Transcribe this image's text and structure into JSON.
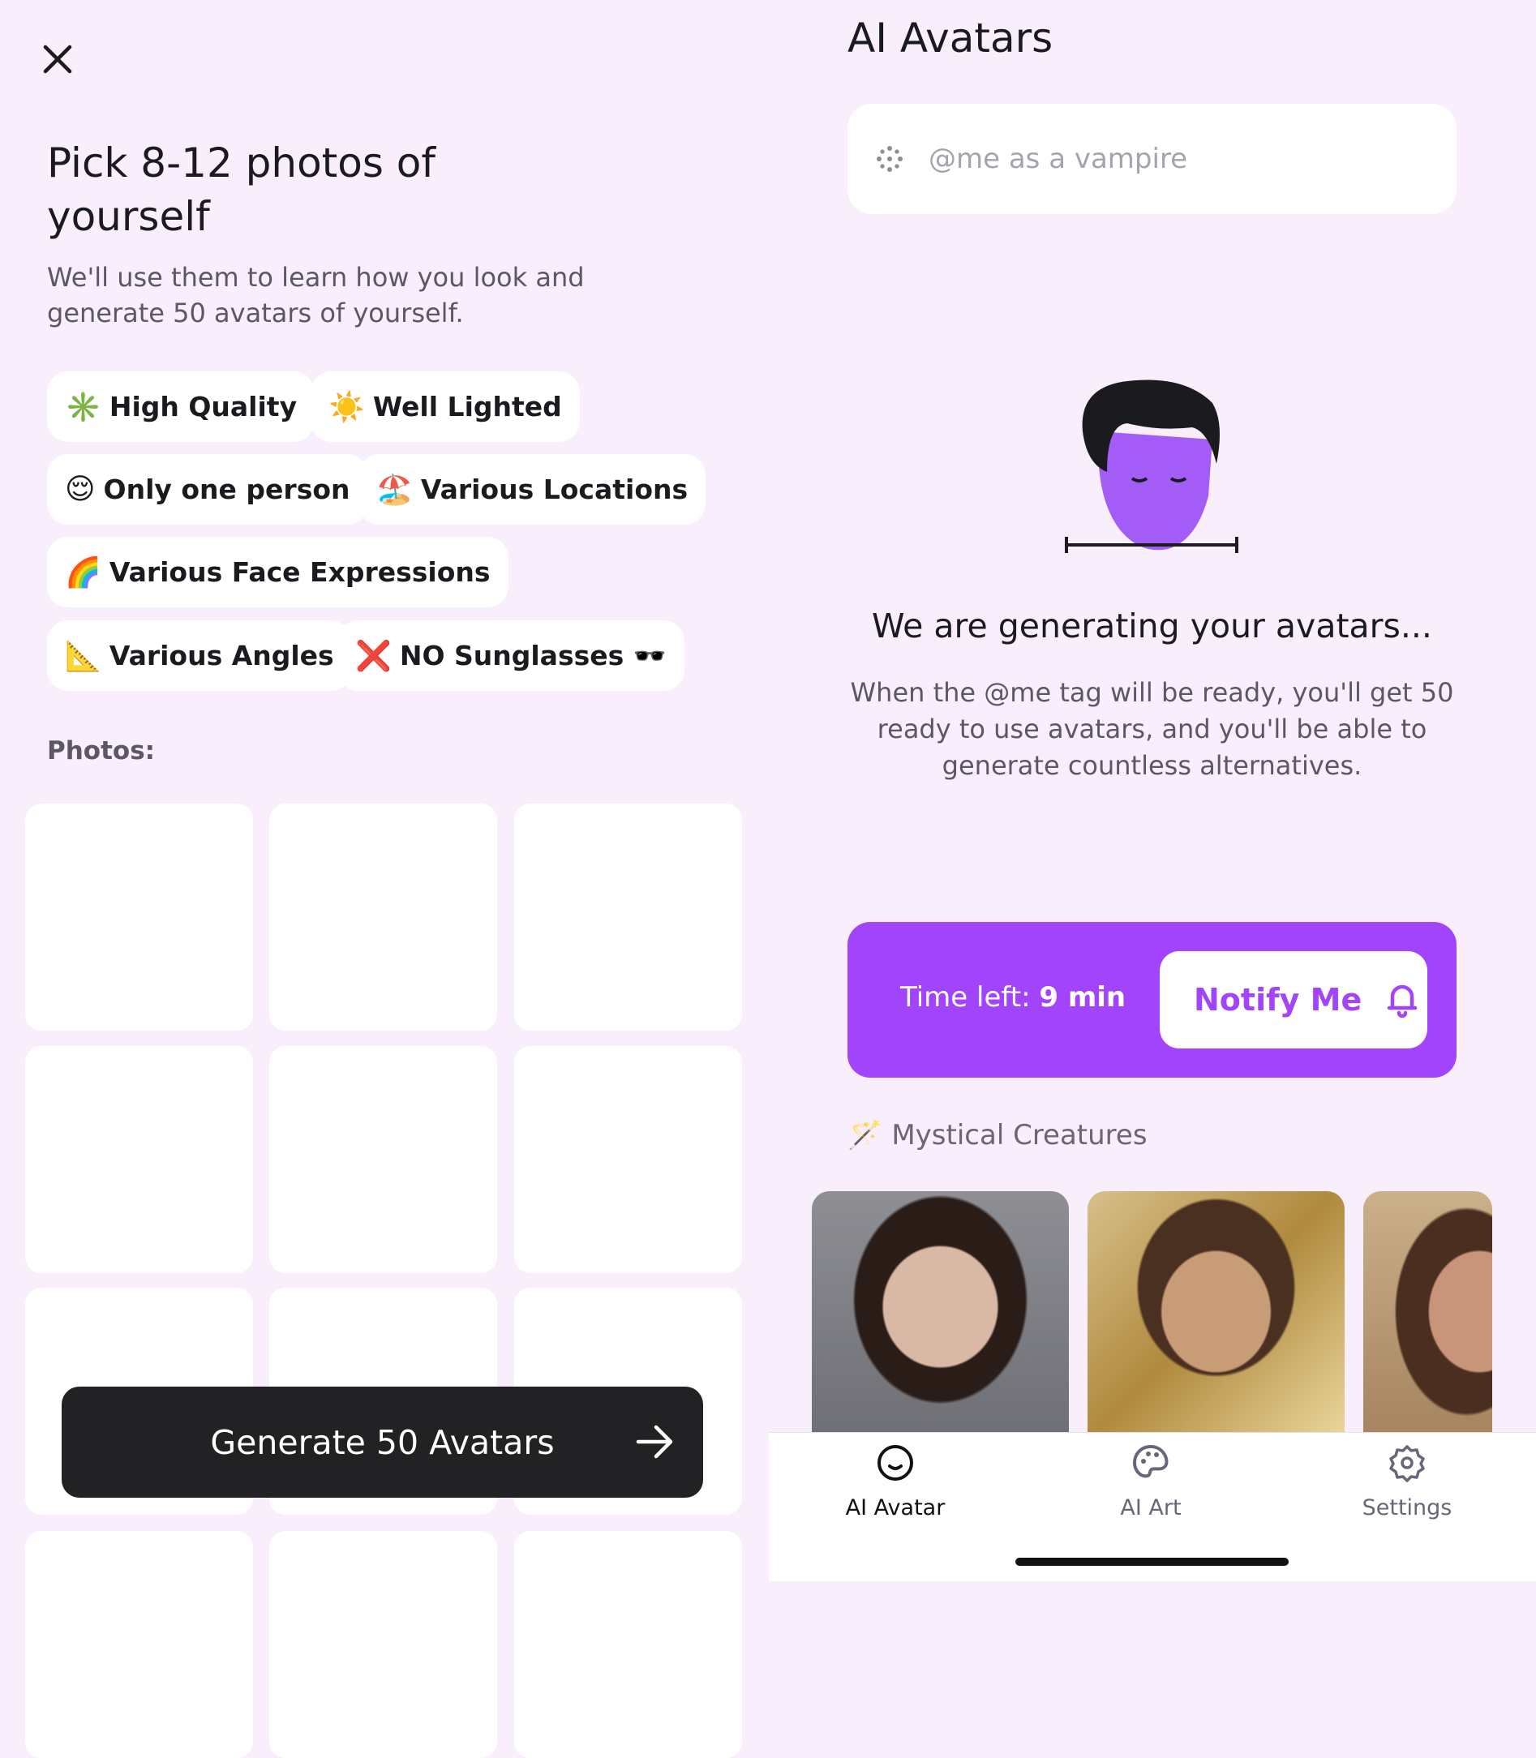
{
  "left": {
    "title": "Pick 8-12 photos of yourself",
    "subtitle": "We'll use them to learn how you look and generate 50 avatars of yourself.",
    "chips": [
      {
        "emoji": "✳️",
        "label": "High Quality"
      },
      {
        "emoji": "☀️",
        "label": "Well Lighted"
      },
      {
        "emoji": "😌",
        "label": "Only one person"
      },
      {
        "emoji": "🏖️",
        "label": "Various Locations"
      },
      {
        "emoji": "🌈",
        "label": "Various Face Expressions"
      },
      {
        "emoji": "📐",
        "label": "Various Angles"
      },
      {
        "emoji": "❌",
        "label": "NO Sunglasses 🕶️"
      }
    ],
    "photos_label": "Photos:",
    "generate_label": "Generate 50 Avatars"
  },
  "right": {
    "title": "AI Avatars",
    "search_placeholder": "@me as a vampire",
    "generating_title": "We are generating your avatars...",
    "generating_desc": "When the @me tag will be ready, you'll get 50 ready to use avatars, and you'll be able to generate countless alternatives.",
    "time_left_label": "Time left:",
    "time_left_value": "9 min",
    "notify_label": "Notify Me",
    "section_emoji": "🪄",
    "section_title": "Mystical Creatures",
    "accent": "#a244fb"
  },
  "tabs": [
    {
      "label": "AI Avatar",
      "icon": "smile-icon",
      "active": true
    },
    {
      "label": "AI Art",
      "icon": "palette-icon",
      "active": false
    },
    {
      "label": "Settings",
      "icon": "gear-icon",
      "active": false
    }
  ]
}
